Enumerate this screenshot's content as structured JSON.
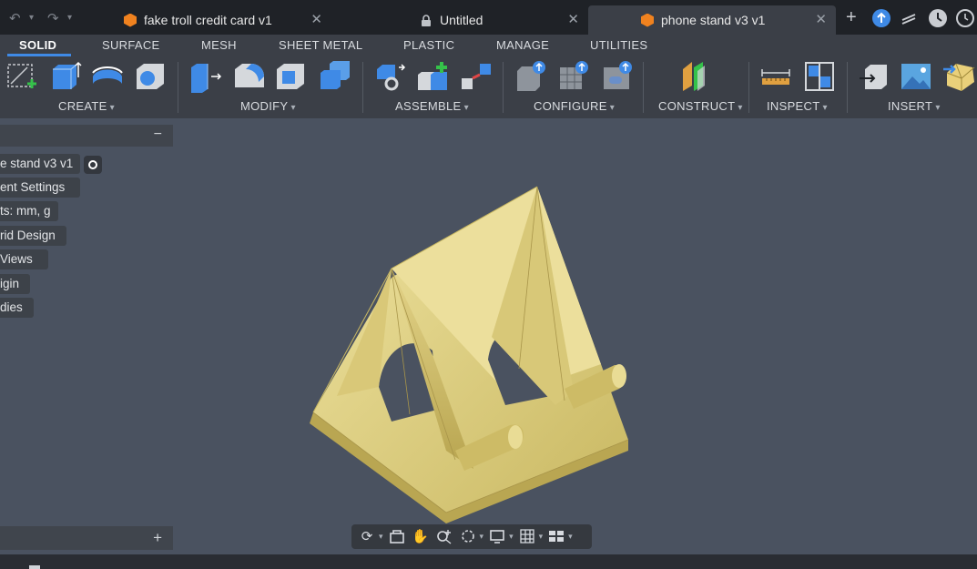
{
  "tabs": [
    {
      "label": "fake troll credit card v1",
      "icon": "document-icon"
    },
    {
      "label": "Untitled",
      "icon": "lock-icon"
    },
    {
      "label": "phone stand v3 v1",
      "icon": "document-icon",
      "active": true
    }
  ],
  "menu": [
    "SOLID",
    "SURFACE",
    "MESH",
    "SHEET METAL",
    "PLASTIC",
    "MANAGE",
    "UTILITIES"
  ],
  "groups": [
    "CREATE",
    "MODIFY",
    "ASSEMBLE",
    "CONFIGURE",
    "CONSTRUCT",
    "INSPECT",
    "INSERT"
  ],
  "browser": {
    "items": [
      "e stand v3 v1",
      "ent Settings",
      "ts: mm, g",
      "rid Design",
      " Views",
      "igin",
      "dies"
    ]
  },
  "colors": {
    "accent": "#3f8ae6",
    "tab_doc": "#f0821f",
    "model": "#e8d98c",
    "background": "#4a5260"
  }
}
